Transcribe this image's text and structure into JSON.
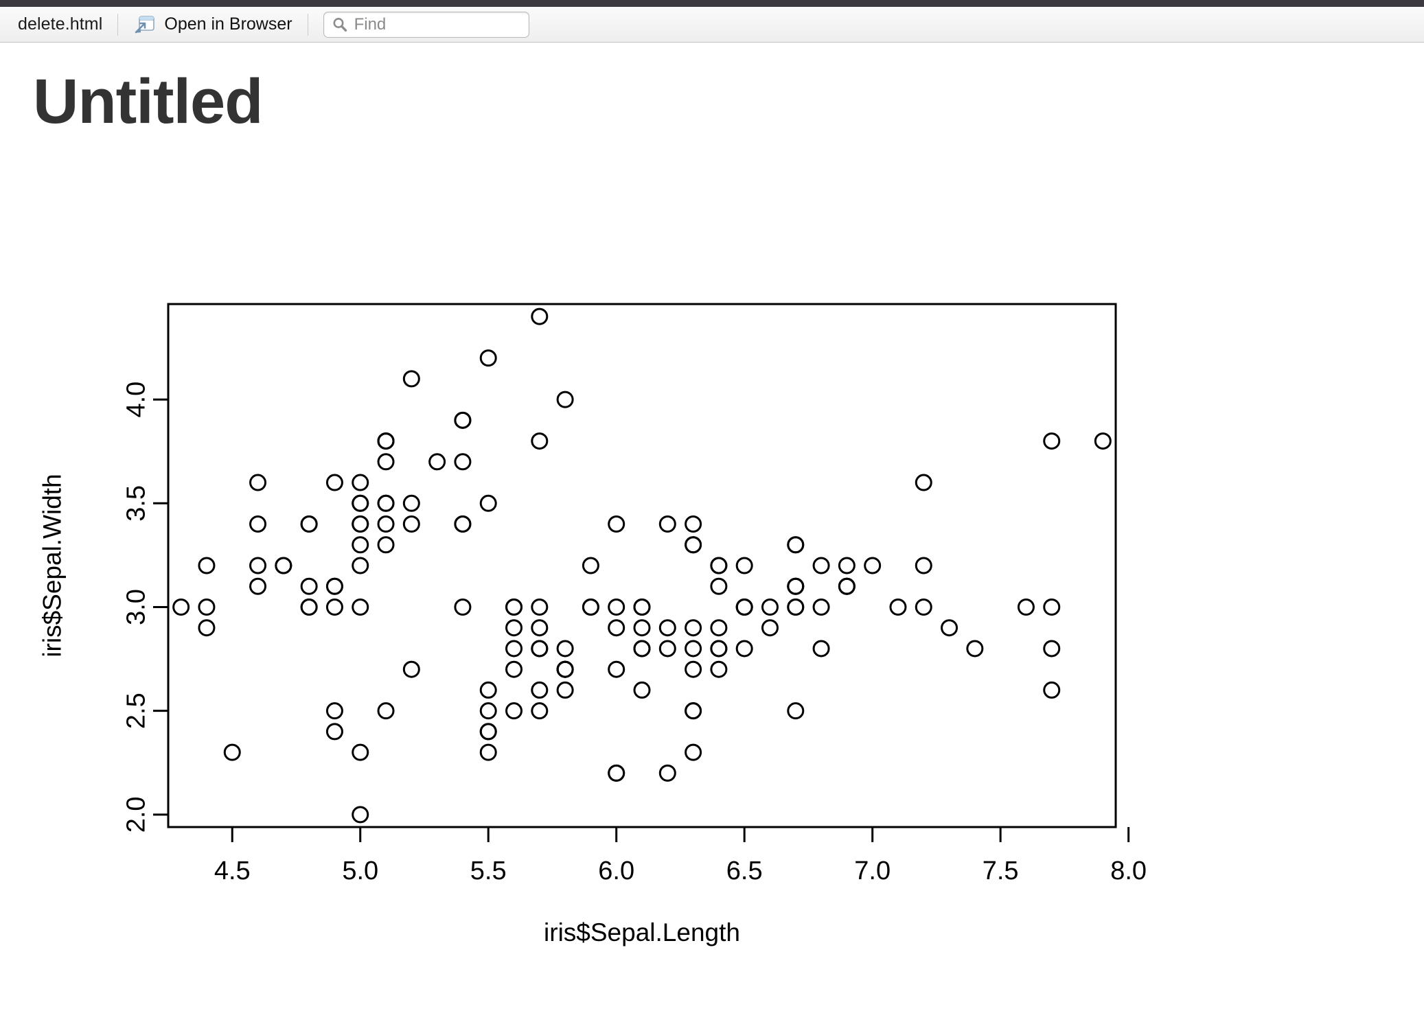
{
  "toolbar": {
    "filename": "delete.html",
    "open_in_browser_label": "Open in Browser",
    "open_in_browser_icon": "open-in-browser-icon",
    "find_placeholder": "Find",
    "find_value": "",
    "find_icon": "search-icon"
  },
  "document": {
    "title": "Untitled"
  },
  "chart_data": {
    "type": "scatter",
    "title": "",
    "xlabel": "iris$Sepal.Length",
    "ylabel": "iris$Sepal.Width",
    "xlim": [
      4.25,
      7.95
    ],
    "ylim": [
      1.94,
      4.46
    ],
    "xticks": [
      "4.5",
      "5.0",
      "5.5",
      "6.0",
      "6.5",
      "7.0",
      "7.5",
      "8.0"
    ],
    "xtick_values": [
      4.5,
      5.0,
      5.5,
      6.0,
      6.5,
      7.0,
      7.5,
      8.0
    ],
    "yticks": [
      "2.0",
      "2.5",
      "3.0",
      "3.5",
      "4.0"
    ],
    "ytick_values": [
      2.0,
      2.5,
      3.0,
      3.5,
      4.0
    ],
    "grid": false,
    "legend": null,
    "marker": "open-circle",
    "marker_color": "#000000",
    "point_count": 150,
    "x": [
      5.1,
      4.9,
      4.7,
      4.6,
      5.0,
      5.4,
      4.6,
      5.0,
      4.4,
      4.9,
      5.4,
      4.8,
      4.8,
      4.3,
      5.8,
      5.7,
      5.4,
      5.1,
      5.7,
      5.1,
      5.4,
      5.1,
      4.6,
      5.1,
      4.8,
      5.0,
      5.0,
      5.2,
      5.2,
      4.7,
      4.8,
      5.4,
      5.2,
      5.5,
      4.9,
      5.0,
      5.5,
      4.9,
      4.4,
      5.1,
      5.0,
      4.5,
      4.4,
      5.0,
      5.1,
      4.8,
      5.1,
      4.6,
      5.3,
      5.0,
      7.0,
      6.4,
      6.9,
      5.5,
      6.5,
      5.7,
      6.3,
      4.9,
      6.6,
      5.2,
      5.0,
      5.9,
      6.0,
      6.1,
      5.6,
      6.7,
      5.6,
      5.8,
      6.2,
      5.6,
      5.9,
      6.1,
      6.3,
      6.1,
      6.4,
      6.6,
      6.8,
      6.7,
      6.0,
      5.7,
      5.5,
      5.5,
      5.8,
      6.0,
      5.4,
      6.0,
      6.7,
      6.3,
      5.6,
      5.5,
      5.5,
      6.1,
      5.8,
      5.0,
      5.6,
      5.7,
      5.7,
      6.2,
      5.1,
      5.7,
      6.3,
      5.8,
      7.1,
      6.3,
      6.5,
      7.6,
      4.9,
      7.3,
      6.7,
      7.2,
      6.5,
      6.4,
      6.8,
      5.7,
      5.8,
      6.4,
      6.5,
      7.7,
      7.7,
      6.0,
      6.9,
      5.6,
      7.7,
      6.3,
      6.7,
      7.2,
      6.2,
      6.1,
      6.4,
      7.2,
      7.4,
      7.9,
      6.4,
      6.3,
      6.1,
      7.7,
      6.3,
      6.4,
      6.0,
      6.9,
      6.7,
      6.9,
      5.8,
      6.8,
      6.7,
      6.7,
      6.3,
      6.5,
      6.2,
      5.9
    ],
    "y": [
      3.5,
      3.0,
      3.2,
      3.1,
      3.6,
      3.9,
      3.4,
      3.4,
      2.9,
      3.1,
      3.7,
      3.4,
      3.0,
      3.0,
      4.0,
      4.4,
      3.9,
      3.5,
      3.8,
      3.8,
      3.4,
      3.7,
      3.6,
      3.3,
      3.4,
      3.0,
      3.4,
      3.5,
      3.4,
      3.2,
      3.1,
      3.4,
      4.1,
      4.2,
      3.1,
      3.2,
      3.5,
      3.6,
      3.0,
      3.4,
      3.5,
      2.3,
      3.2,
      3.5,
      3.8,
      3.0,
      3.8,
      3.2,
      3.7,
      3.3,
      3.2,
      3.2,
      3.1,
      2.3,
      2.8,
      2.8,
      3.3,
      2.4,
      2.9,
      2.7,
      2.0,
      3.0,
      2.2,
      2.9,
      2.9,
      3.1,
      3.0,
      2.7,
      2.2,
      2.5,
      3.2,
      2.8,
      2.5,
      2.8,
      2.9,
      3.0,
      2.8,
      3.0,
      2.9,
      2.6,
      2.4,
      2.4,
      2.7,
      2.7,
      3.0,
      3.4,
      3.1,
      2.3,
      3.0,
      2.5,
      2.6,
      3.0,
      2.6,
      2.3,
      2.7,
      3.0,
      2.9,
      2.9,
      2.5,
      2.8,
      3.3,
      2.7,
      3.0,
      2.9,
      3.0,
      3.0,
      2.5,
      2.9,
      2.5,
      3.6,
      3.2,
      2.7,
      3.0,
      2.5,
      2.8,
      3.2,
      3.0,
      3.8,
      2.6,
      2.2,
      3.2,
      2.8,
      2.8,
      2.7,
      3.3,
      3.2,
      2.8,
      3.0,
      2.8,
      3.0,
      2.8,
      3.8,
      2.8,
      2.8,
      2.6,
      3.0,
      3.4,
      3.1,
      3.0,
      3.1,
      3.1,
      3.1,
      2.7,
      3.2,
      3.3,
      3.0,
      2.5,
      3.0,
      3.4,
      3.0
    ]
  }
}
